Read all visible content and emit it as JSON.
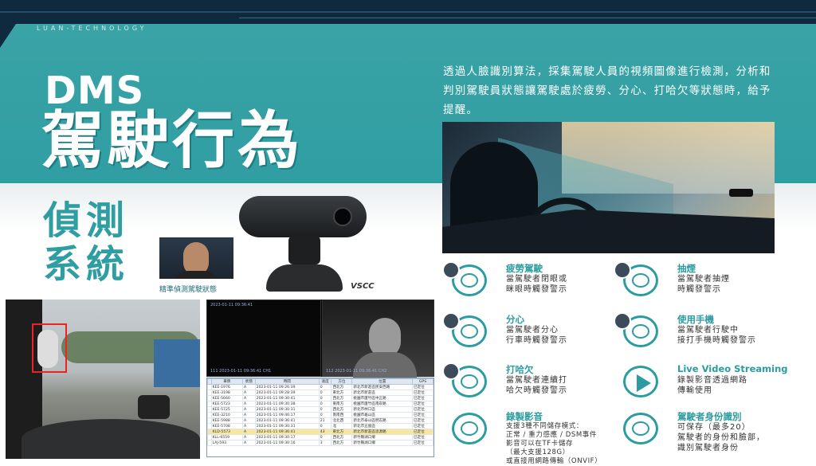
{
  "brand": "LUAN-TECHNOLOGY",
  "headline": {
    "prefix": "DMS",
    "title": "駕駛行為",
    "subtitle_line1": "偵測",
    "subtitle_line2": "系統"
  },
  "intro_text": "透過人臉識別算法，採集駕駛人員的視頻圖像進行檢測，分析和判別駕駛員狀態讓駕駛處於疲勞、分心、打哈欠等狀態時，給予提醒。",
  "face_caption": "精準偵測駕駛狀態",
  "device_brand": "VSCC",
  "feeds": {
    "left_timestamp": "2023-01-11 09:36:41",
    "left_caption": "111 2023-01-11 09:36:41  CH1",
    "right_caption": "112 2023-01-11 09:36:41  CH2"
  },
  "grid": {
    "headers": [
      "",
      "車牌",
      "狀態",
      "時間",
      "速度",
      "方位",
      "位置",
      "GPS"
    ],
    "rows": [
      [
        "",
        "KEE-1976",
        "A",
        "2023-01-11 09:26:39",
        "0",
        "西北方",
        "新北市新莊區民安西路",
        "已定位"
      ],
      [
        "",
        "KEE-3198",
        "A",
        "2023-01-11 09:28:39",
        "0",
        "東北方",
        "新北市新莊區",
        "已定位"
      ],
      [
        "",
        "KEE-5660",
        "A",
        "2023-01-11 09:30:41",
        "0",
        "西北方",
        "桃園市蘆竹區中正路",
        "已定位"
      ],
      [
        "",
        "KEE-5723",
        "A",
        "2023-01-11 09:30:38",
        "0",
        "東南方",
        "桃園市蘆竹區南崁路",
        "已定位"
      ],
      [
        "",
        "KEE-5725",
        "A",
        "2023-01-11 09:30:31",
        "0",
        "西北方",
        "新北市林口區",
        "已定位"
      ],
      [
        "",
        "KEE-3210",
        "A",
        "2023-01-11 09:46:17",
        "0",
        "南南西",
        "桃園市龜山區",
        "已定位"
      ],
      [
        "",
        "KEE-5988",
        "A",
        "2023-01-11 09:36:41",
        "21",
        "北北西",
        "新北市泰山區明志路",
        "已定位"
      ],
      [
        "",
        "KEE-5708",
        "A",
        "2023-01-11 09:30:31",
        "0",
        "北",
        "新北市五股區",
        "已定位"
      ],
      [
        "",
        "KLD-5573",
        "A",
        "2023-01-11 09:36:41",
        "43",
        "東北方",
        "新北市新莊區思源路",
        "已定位"
      ],
      [
        "",
        "KLL-6559",
        "A",
        "2023-01-11 09:30:17",
        "0",
        "西北方",
        "新竹縣湖口鄉",
        "已定位"
      ],
      [
        "",
        "LAJ-593",
        "A",
        "2023-01-11 09:30:16",
        "3",
        "西北方",
        "新竹縣湖口鄉",
        "已定位"
      ]
    ]
  },
  "features": [
    {
      "title": "疲勞駕駛",
      "text": "當駕駛者閉眼或\n眯眼時觸發警示",
      "icon": "drowsy-face-icon"
    },
    {
      "title": "抽煙",
      "text": "當駕駛者抽煙\n時觸發警示",
      "icon": "smoking-face-icon"
    },
    {
      "title": "分心",
      "text": "當駕駛者分心\n行車時觸發警示",
      "icon": "distracted-face-icon"
    },
    {
      "title": "使用手機",
      "text": "當駕駛者行駛中\n接打手機時觸發警示",
      "icon": "phone-face-icon"
    },
    {
      "title": "打哈欠",
      "text": "當駕駛者連續打\n哈欠時觸發警示",
      "icon": "yawn-face-icon"
    },
    {
      "title": "Live Video Streaming",
      "text": "錄製影音透過網路\n傳輸使用",
      "icon": "play-icon"
    },
    {
      "title": "錄製影音",
      "text": "支援3種不同儲存模式：\n正常 / 重力感應 / DSM事件\n影音可以在TF卡儲存\n（最大支援128G）\n或直接用網路傳輸（ONVIF）",
      "icon": "record-icon"
    },
    {
      "title": "駕駛者身份識別",
      "text": "可保存（最多20）\n駕駛者的身份和臉部，\n識別駕駛者身份",
      "icon": "id-face-icon"
    }
  ],
  "colors": {
    "teal": "#2f9ea3",
    "dark_bar": "#0f2a3f",
    "accent": "#2b9ca0"
  }
}
